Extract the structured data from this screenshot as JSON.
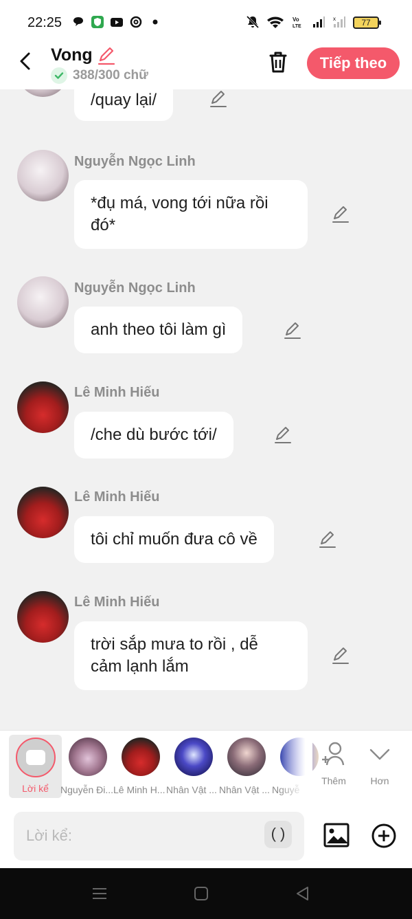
{
  "status_bar": {
    "time": "22:25",
    "left_icons": [
      "chat-bubble-icon",
      "shield-app-icon",
      "youtube-icon",
      "threads-icon",
      "dot-icon"
    ],
    "right_icons": [
      "mute-icon",
      "wifi-icon",
      "volte-icon",
      "signal-icon",
      "signal-icon"
    ],
    "volte_label": "Vo\nLTE",
    "battery": "77"
  },
  "header": {
    "title": "Vong",
    "count": "388/300 chữ",
    "next_label": "Tiếp theo",
    "accent": "#f4596b"
  },
  "messages": [
    {
      "speaker": "",
      "text": "/quay lại/",
      "avatar": "white"
    },
    {
      "speaker": "Nguyễn Ngọc Linh",
      "text": "*đụ má, vong tới nữa rồi đó*",
      "avatar": "white"
    },
    {
      "speaker": "Nguyễn Ngọc Linh",
      "text": "anh theo tôi làm gì",
      "avatar": "white"
    },
    {
      "speaker": "Lê Minh Hiếu",
      "text": "/che dù bước tới/",
      "avatar": "red"
    },
    {
      "speaker": "Lê Minh Hiếu",
      "text": "tôi chỉ muốn đưa cô về",
      "avatar": "red"
    },
    {
      "speaker": "Lê Minh Hiếu",
      "text": "trời sắp mưa to rồi , dễ cảm lạnh lắm",
      "avatar": "red"
    }
  ],
  "characters": {
    "narrator_label": "Lời kể",
    "list": [
      {
        "label": "Nguyễn Đi..."
      },
      {
        "label": "Lê Minh H..."
      },
      {
        "label": "Nhân Vật ..."
      },
      {
        "label": "Nhân Vật ..."
      },
      {
        "label": "Nguyễ"
      }
    ],
    "add_label": "Thêm",
    "more_label": "Hơn"
  },
  "input": {
    "placeholder": "Lời kể:",
    "paren": "( )"
  }
}
